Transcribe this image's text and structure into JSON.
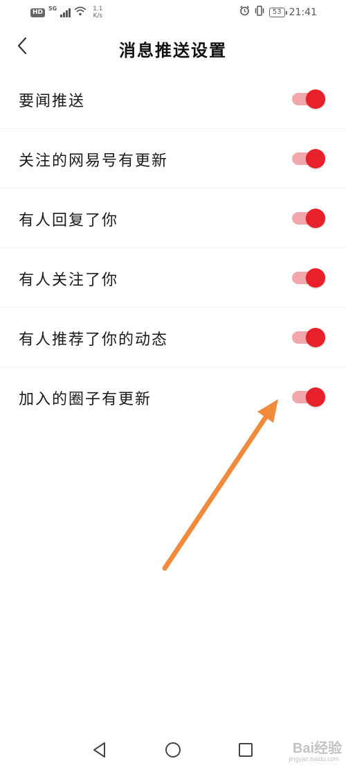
{
  "status_bar": {
    "hd": "HD",
    "network": "5G",
    "speed_value": "1.1",
    "speed_unit": "K/s",
    "battery": "53",
    "time": "21:41"
  },
  "header": {
    "title": "消息推送设置"
  },
  "settings": [
    {
      "label": "要闻推送",
      "enabled": true
    },
    {
      "label": "关注的网易号有更新",
      "enabled": true
    },
    {
      "label": "有人回复了你",
      "enabled": true
    },
    {
      "label": "有人关注了你",
      "enabled": true
    },
    {
      "label": "有人推荐了你的动态",
      "enabled": true
    },
    {
      "label": "加入的圈子有更新",
      "enabled": true
    }
  ],
  "colors": {
    "accent": "#e8202a",
    "track_on": "#f2a8aa",
    "annotation_arrow": "#f28a3c"
  },
  "watermark": {
    "brand": "Bai经验",
    "url": "jingyan.baidu.com"
  }
}
